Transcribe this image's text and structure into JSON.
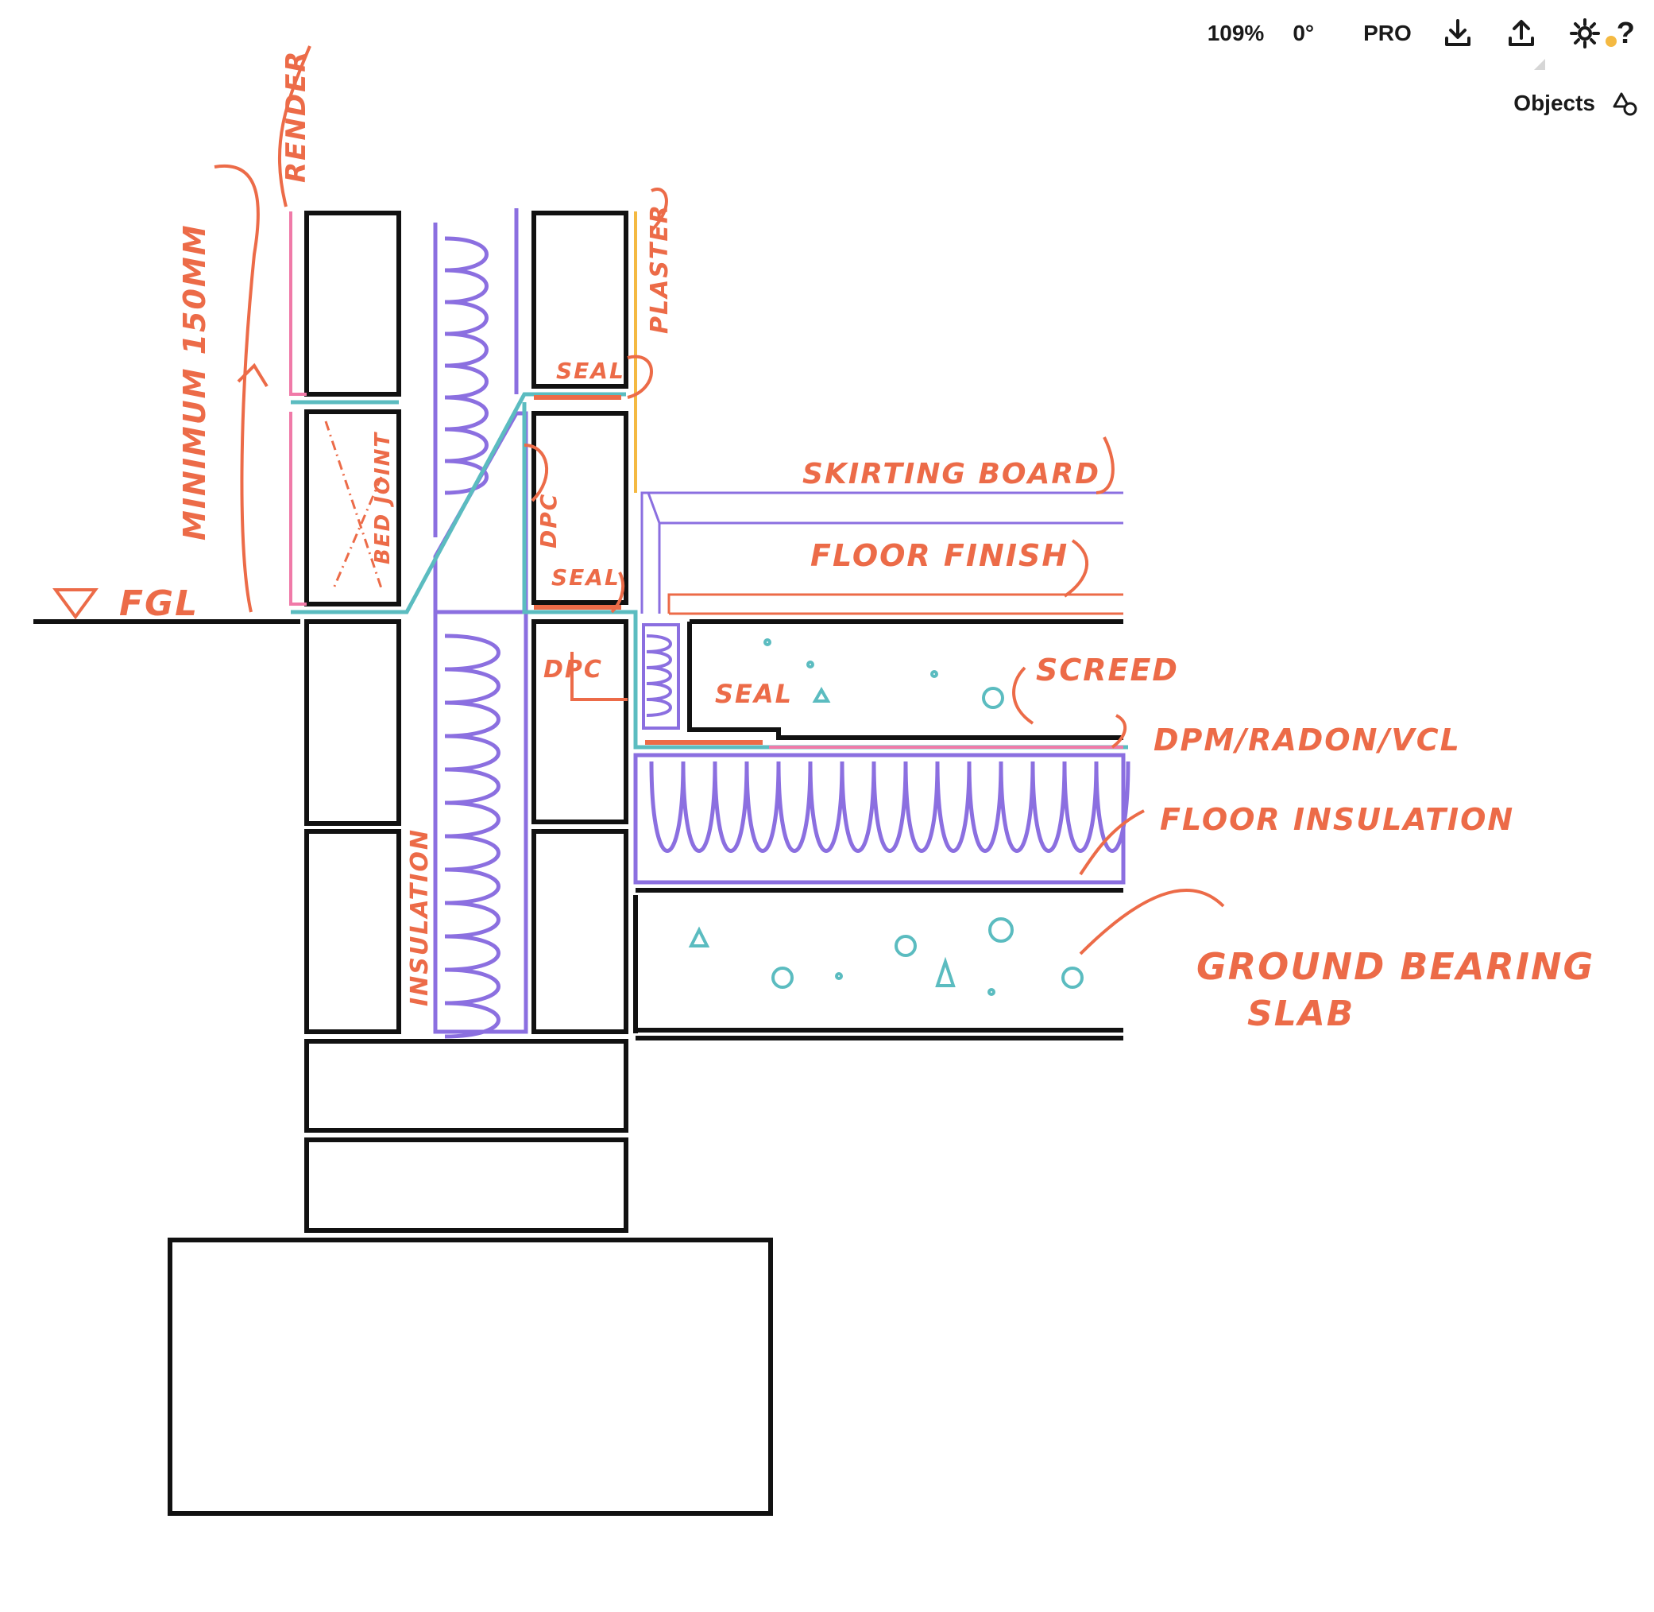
{
  "toolbar": {
    "zoom": "109%",
    "rotation": "0°",
    "pro_label": "PRO",
    "icons": [
      "download-icon",
      "share-icon",
      "settings-gear-icon",
      "help-icon"
    ],
    "help_label": "?",
    "help_dot_color": "#f4b942"
  },
  "objects_panel": {
    "label": "Objects",
    "icon": "shapes-icon"
  },
  "colors": {
    "ink": "#111111",
    "annotation": "#ec6b48",
    "insulation": "#8b6fe0",
    "seal_line": "#5bbcc0",
    "render": "#f07aa8",
    "plaster": "#f4b942"
  },
  "drawing": {
    "annotations": {
      "render": "RENDER",
      "minimum": "MINIMUM 150MM",
      "fgl": "FGL",
      "bed_joint": "BED JOINT",
      "plaster": "PLASTER",
      "seal_top": "SEAL",
      "dpc_upper": "DPC",
      "seal_mid": "SEAL",
      "skirting": "SKIRTING BOARD",
      "floor_finish": "FLOOR FINISH",
      "dpc_lower": "DPC",
      "seal_low": "SEAL",
      "screed": "SCREED",
      "dpm": "DPM/RADON/VCL",
      "floor_insulation": "FLOOR INSULATION",
      "cavity_insulation": "INSULATION",
      "ground_slab_1": "GROUND BEARING",
      "ground_slab_2": "SLAB"
    }
  }
}
